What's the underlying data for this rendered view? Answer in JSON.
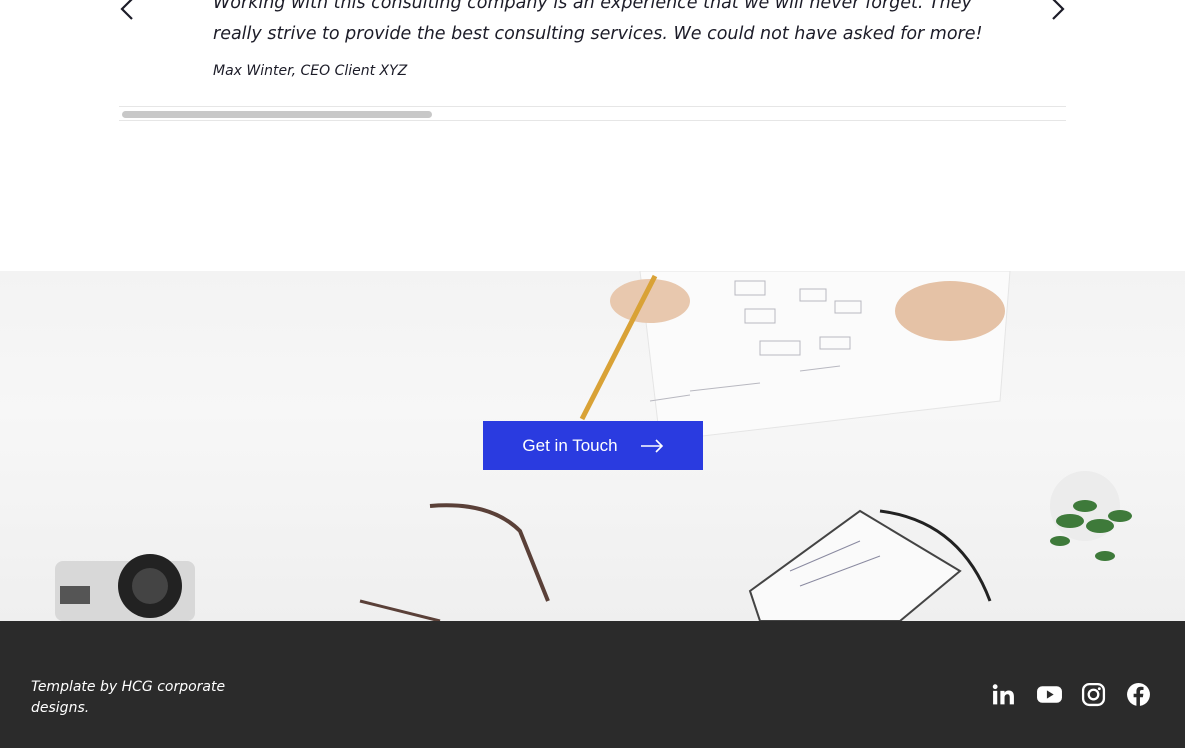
{
  "testimonial": {
    "quote": "Working with this consulting company is an experience that we will never forget. They really strive to provide the best consulting services. We could not have asked for more!",
    "author": "Max Winter, CEO Client XYZ",
    "prev_icon": "chevron-left-icon",
    "next_icon": "chevron-right-icon"
  },
  "cta": {
    "label": "Get in Touch",
    "icon": "arrow-right-icon",
    "color": "#2a3be0"
  },
  "footer": {
    "credit": "Template by HCG corporate designs.",
    "background": "#2b2b2b",
    "socials": [
      {
        "name": "linkedin-icon"
      },
      {
        "name": "youtube-icon"
      },
      {
        "name": "instagram-icon"
      },
      {
        "name": "facebook-icon"
      }
    ]
  }
}
